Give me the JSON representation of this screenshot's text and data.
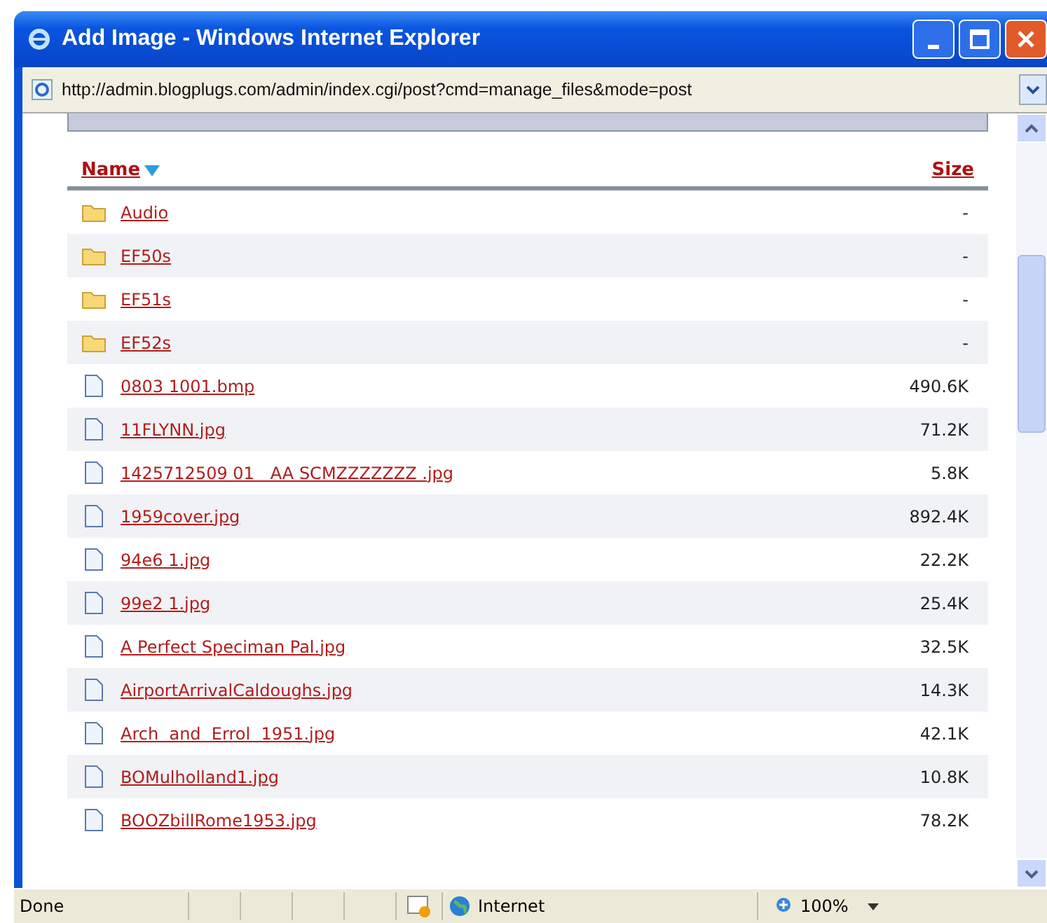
{
  "window": {
    "title": "Add Image - Windows Internet Explorer"
  },
  "address_bar": {
    "url": "http://admin.blogplugs.com/admin/index.cgi/post?cmd=manage_files&mode=post"
  },
  "table": {
    "columns": [
      {
        "label": "Name",
        "sorted": true
      },
      {
        "label": "Size",
        "sorted": false
      }
    ],
    "rows": [
      {
        "kind": "folder",
        "name": "Audio",
        "size": "-"
      },
      {
        "kind": "folder",
        "name": "EF50s",
        "size": "-"
      },
      {
        "kind": "folder",
        "name": "EF51s",
        "size": "-"
      },
      {
        "kind": "folder",
        "name": "EF52s",
        "size": "-"
      },
      {
        "kind": "file",
        "name": "0803 1001.bmp",
        "size": "490.6K"
      },
      {
        "kind": "file",
        "name": "11FLYNN.jpg",
        "size": "71.2K"
      },
      {
        "kind": "file",
        "name": "1425712509 01   AA SCMZZZZZZZ .jpg",
        "size": "5.8K"
      },
      {
        "kind": "file",
        "name": "1959cover.jpg",
        "size": "892.4K"
      },
      {
        "kind": "file",
        "name": "94e6 1.jpg",
        "size": "22.2K"
      },
      {
        "kind": "file",
        "name": "99e2 1.jpg",
        "size": "25.4K"
      },
      {
        "kind": "file",
        "name": "A Perfect Speciman Pal.jpg",
        "size": "32.5K"
      },
      {
        "kind": "file",
        "name": "AirportArrivalCaldoughs.jpg",
        "size": "14.3K"
      },
      {
        "kind": "file",
        "name": "Arch  and  Errol  1951.jpg",
        "size": "42.1K"
      },
      {
        "kind": "file",
        "name": "BOMulholland1.jpg",
        "size": "10.8K"
      },
      {
        "kind": "file",
        "name": "BOOZbillRome1953.jpg",
        "size": "78.2K"
      }
    ]
  },
  "status_bar": {
    "status": "Done",
    "zone": "Internet",
    "zoom": "100%"
  }
}
